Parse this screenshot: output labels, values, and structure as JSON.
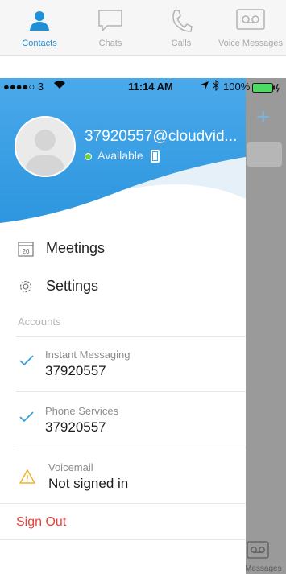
{
  "tabbar": {
    "tabs": [
      {
        "label": "Contacts",
        "icon": "person-icon",
        "active": true
      },
      {
        "label": "Chats",
        "icon": "chat-bubble-icon",
        "active": false
      },
      {
        "label": "Calls",
        "icon": "phone-icon",
        "active": false
      },
      {
        "label": "Voice Messages",
        "icon": "voicemail-icon",
        "active": false
      }
    ]
  },
  "statusbar": {
    "carrier": "●●●●○ 3",
    "time": "11:14 AM",
    "battery": "100%"
  },
  "drawer": {
    "username": "37920557@cloudvid...",
    "presence": "Available",
    "menu": [
      {
        "label": "Meetings",
        "icon": "calendar-icon"
      },
      {
        "label": "Settings",
        "icon": "gear-icon"
      }
    ],
    "accounts_label": "Accounts",
    "accounts": [
      {
        "title": "Instant Messaging",
        "value": "37920557",
        "status_icon": "checkmark-icon"
      },
      {
        "title": "Phone Services",
        "value": "37920557",
        "status_icon": "checkmark-icon"
      },
      {
        "title": "Voicemail",
        "value": "Not signed in",
        "status_icon": "warning-icon"
      }
    ],
    "sign_out": "Sign Out"
  },
  "background": {
    "plus": "+",
    "tab_label": "Messages"
  },
  "colors": {
    "accent": "#1f8fd6",
    "header_blue": "#3fa3e6",
    "available": "#6cd13d",
    "warning": "#f0b429",
    "danger": "#e5443a"
  }
}
